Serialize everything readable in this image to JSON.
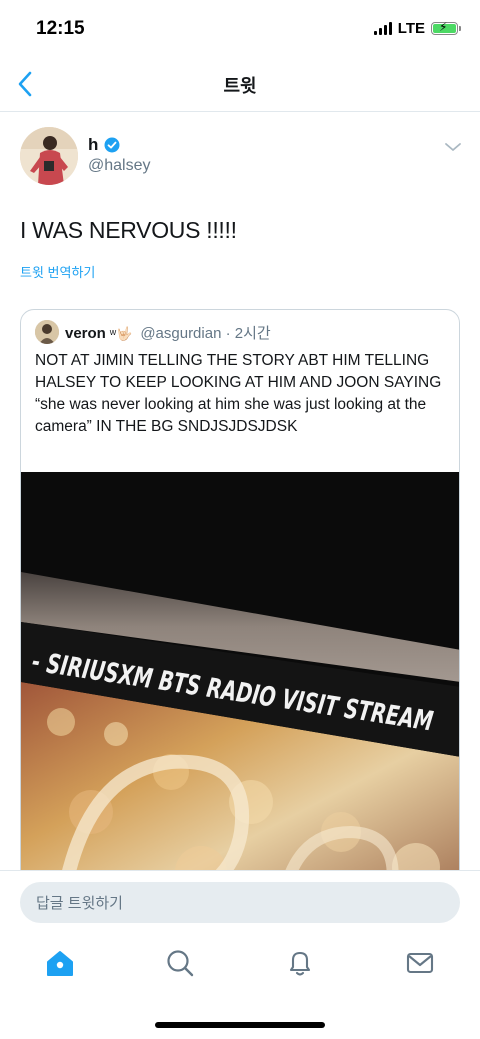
{
  "status_bar": {
    "time": "12:15",
    "network": "LTE",
    "signal_bars": 4,
    "battery_charging": true
  },
  "nav": {
    "title": "트윗",
    "back_icon": "chevron-left-icon"
  },
  "tweet": {
    "author_name": "h",
    "author_handle": "@halsey",
    "verified": true,
    "text": "I WAS NERVOUS !!!!!",
    "translate_label": "트윗 번역하기"
  },
  "quoted_tweet": {
    "author_name": "veron",
    "author_name_emoji": "ʷ🤟🏻",
    "author_handle": "@asgurdian · 2시간",
    "text": "NOT AT JIMIN TELLING THE STORY ABT HIM TELLING HALSEY TO KEEP LOOKING AT HIM AND JOON SAYING “she was never looking at him she was just looking at the camera” IN THE BG SNDJSJDSJDSK",
    "media_banner_text": "- SIRIUSXM BTS RADIO VISIT STREAM"
  },
  "reply": {
    "placeholder": "답글 트윗하기"
  },
  "tab_bar": {
    "tabs": [
      "home-icon",
      "search-icon",
      "notifications-icon",
      "messages-icon"
    ],
    "active": "home-icon"
  },
  "colors": {
    "accent": "#1da1f2",
    "text": "#14171a",
    "secondary": "#657786",
    "divider": "#e1e8ed"
  }
}
